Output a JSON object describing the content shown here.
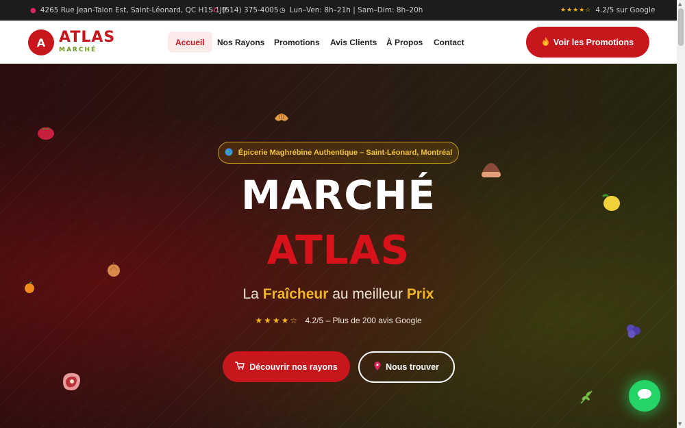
{
  "topbar": {
    "address": "4265 Rue Jean-Talon Est, Saint-Léonard, QC H1S 1J9",
    "phone": "(514) 375-4005",
    "hours": "Lun–Ven: 8h–21h | Sam–Dim: 8h–20h",
    "google_stars": "★★★★☆",
    "google_rating": "4.2/5 sur Google",
    "icons": [
      "map-pin-icon",
      "phone-icon",
      "clock-icon"
    ]
  },
  "navbar": {
    "logo_letter": "A",
    "logo_name": "ATLAS",
    "logo_sub": "MARCHÉ",
    "links": [
      {
        "label": "Accueil",
        "active": true
      },
      {
        "label": "Nos Rayons",
        "active": false
      },
      {
        "label": "Promotions",
        "active": false
      },
      {
        "label": "Avis Clients",
        "active": false
      },
      {
        "label": "À Propos",
        "active": false
      },
      {
        "label": "Contact",
        "active": false
      }
    ],
    "cta_label": "Voir les Promotions",
    "cta_icon": "fire-icon"
  },
  "hero": {
    "badge_text": "Épicerie Maghrébine Authentique – Saint-Léonard, Montréal",
    "badge_icon": "globe-icon",
    "title_line1": "MARCHÉ",
    "title_line2": "ATLAS",
    "tagline_pre": "La",
    "tagline_word1": "Fraîcheur",
    "tagline_mid": "au meilleur",
    "tagline_word2": "Prix",
    "rating_stars": "★★★★☆",
    "rating_text": "4.2/5 – Plus de 200 avis Google",
    "btn_primary": "Découvrir nos rayons",
    "btn_primary_icon": "cart-icon",
    "btn_secondary": "Nous trouver",
    "btn_secondary_icon": "map-pin-icon"
  },
  "colors": {
    "brand_red": "#c8161d",
    "accent_gold": "#f2b524",
    "green": "#6f9a1f",
    "chat_green": "#25d366"
  },
  "decorations": [
    "tomato-icon",
    "croissant-icon",
    "chestnut-icon",
    "lemon-icon",
    "onion-icon",
    "orange-icon",
    "blueberries-icon",
    "meat-icon",
    "herb-icon"
  ],
  "chat": {
    "icon": "chat-icon"
  }
}
